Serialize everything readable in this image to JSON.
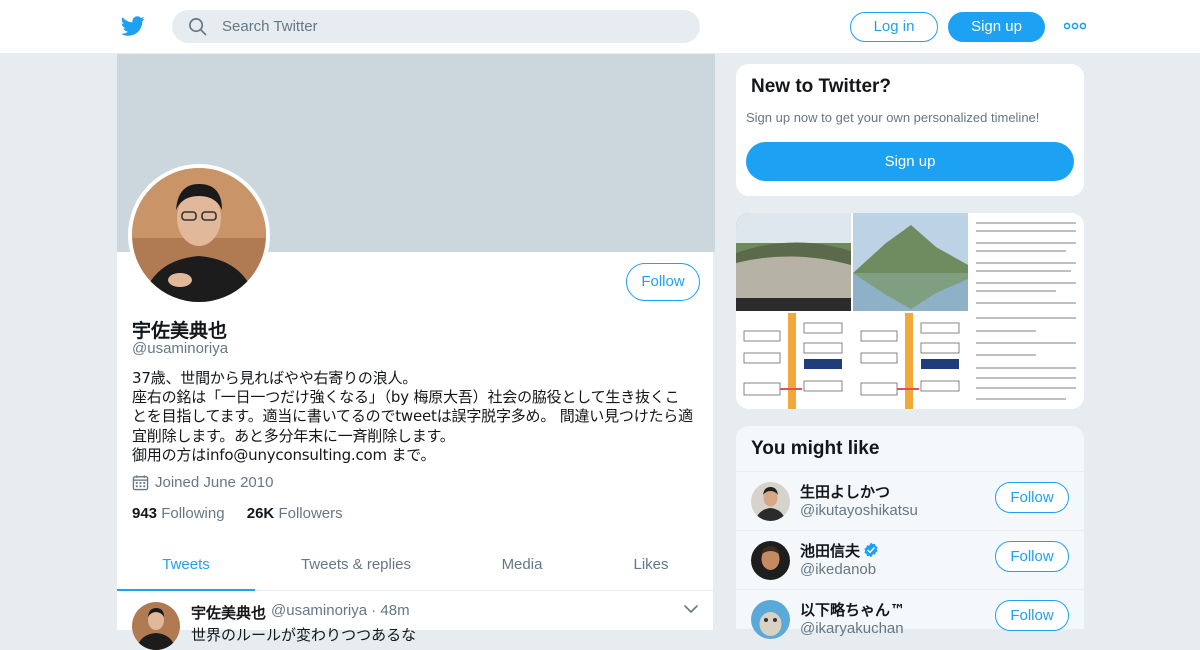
{
  "header": {
    "search_placeholder": "Search Twitter",
    "login_label": "Log in",
    "signup_label": "Sign up",
    "brand_color": "#1da1f2"
  },
  "profile": {
    "display_name": "宇佐美典也",
    "handle": "@usaminoriya",
    "follow_label": "Follow",
    "bio_lines": [
      "37歳、世間から見ればやや右寄りの浪人。",
      "座右の銘は「一日一つだけ強くなる」（by 梅原大吾）社会の脇役として生き抜くこ",
      "とを目指してます。適当に書いてるのでtweetは誤字脱字多め。 間違い見つけたら適",
      "宜削除します。あと多分年末に一斉削除します。",
      "御用の方はinfo@unyconsulting.com まで。"
    ],
    "joined": "Joined June 2010",
    "following_count": "943",
    "following_label": "Following",
    "followers_count": "26K",
    "followers_label": "Followers"
  },
  "tabs": [
    {
      "label": "Tweets",
      "active": true
    },
    {
      "label": "Tweets & replies",
      "active": false
    },
    {
      "label": "Media",
      "active": false
    },
    {
      "label": "Likes",
      "active": false
    }
  ],
  "tweet": {
    "name": "宇佐美典也",
    "handle_time": "@usaminoriya · 48m",
    "text": "世界のルールが変わりつつあるな"
  },
  "new_to_twitter": {
    "title": "New to Twitter?",
    "subtitle": "Sign up now to get your own personalized timeline!",
    "signup_label": "Sign up"
  },
  "you_might_like": {
    "title": "You might like",
    "users": [
      {
        "name": "生田よしかつ",
        "handle": "@ikutayoshikatsu",
        "follow": "Follow",
        "verified": false
      },
      {
        "name": "池田信夫",
        "handle": "@ikedanob",
        "follow": "Follow",
        "verified": true
      },
      {
        "name": "以下略ちゃん™",
        "handle": "@ikaryakuchan",
        "follow": "Follow",
        "verified": false
      }
    ]
  }
}
